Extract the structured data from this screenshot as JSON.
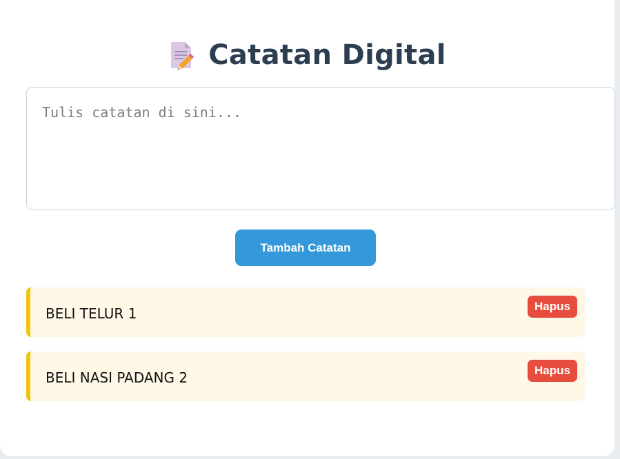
{
  "app": {
    "title": "Catatan Digital",
    "title_icon": "memo-pencil-icon"
  },
  "input": {
    "placeholder": "Tulis catatan di sini...",
    "value": ""
  },
  "add_button": {
    "label": "Tambah Catatan"
  },
  "notes": [
    {
      "text": "BELI TELUR 1",
      "delete_label": "Hapus"
    },
    {
      "text": "BELI NASI PADANG 2",
      "delete_label": "Hapus"
    }
  ],
  "colors": {
    "title": "#2c3e50",
    "primary_button": "#3498db",
    "delete_button": "#e74c3c",
    "note_background": "#fff8e6",
    "note_accent": "#f1c40f"
  }
}
